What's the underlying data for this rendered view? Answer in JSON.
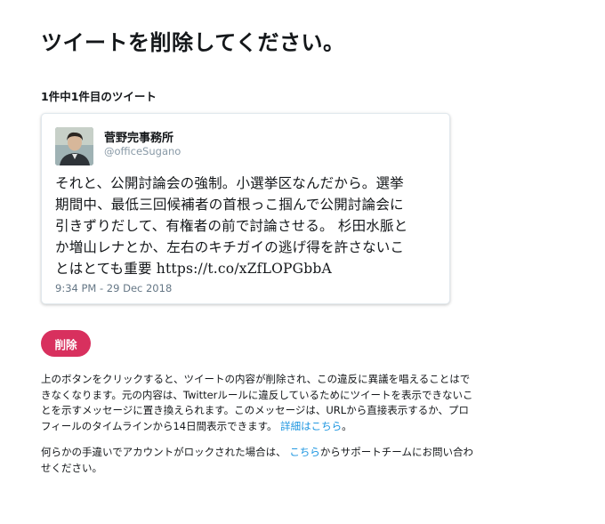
{
  "page": {
    "title": "ツイートを削除してください。",
    "counter": "1件中1件目のツイート"
  },
  "tweet": {
    "author_name": "菅野完事務所",
    "author_handle": "@officeSugano",
    "text_lines": [
      "それと、公開討論会の強制。小選挙区なんだから。選挙",
      "期間中、最低三回候補者の首根っこ掴んで公開討論会に",
      "引きずりだして、有権者の前で討論させる。 杉田水脈と",
      "か増山レナとか、左右のキチガイの逃げ得を許さないこ",
      "とはとても重要 https://t.co/xZfLOPGbbA"
    ],
    "timestamp": "9:34 PM - 29 Dec 2018"
  },
  "actions": {
    "delete_label": "削除"
  },
  "explanation": {
    "lines": [
      "上のボタンをクリックすると、ツイートの内容が削除され、この違反に異議を唱えることはで",
      "きなくなります。元の内容は、Twitterルールに違反しているためにツイートを表示できないこ",
      "とを示すメッセージに置き換えられます。このメッセージは、URLから直接表示するか、プロ",
      "フィールのタイムラインから14日間表示できます。"
    ],
    "details_link": "詳細はこちら",
    "details_suffix": "。"
  },
  "support": {
    "prefix": "何らかの手違いでアカウントがロックされた場合は、",
    "link": "こちら",
    "suffix_line1": "からサポートチームにお問い合わ",
    "suffix_line2": "せください。"
  },
  "colors": {
    "delete_button": "#d8305e",
    "link": "#1b95e0",
    "secondary_text": "#8899a6"
  }
}
